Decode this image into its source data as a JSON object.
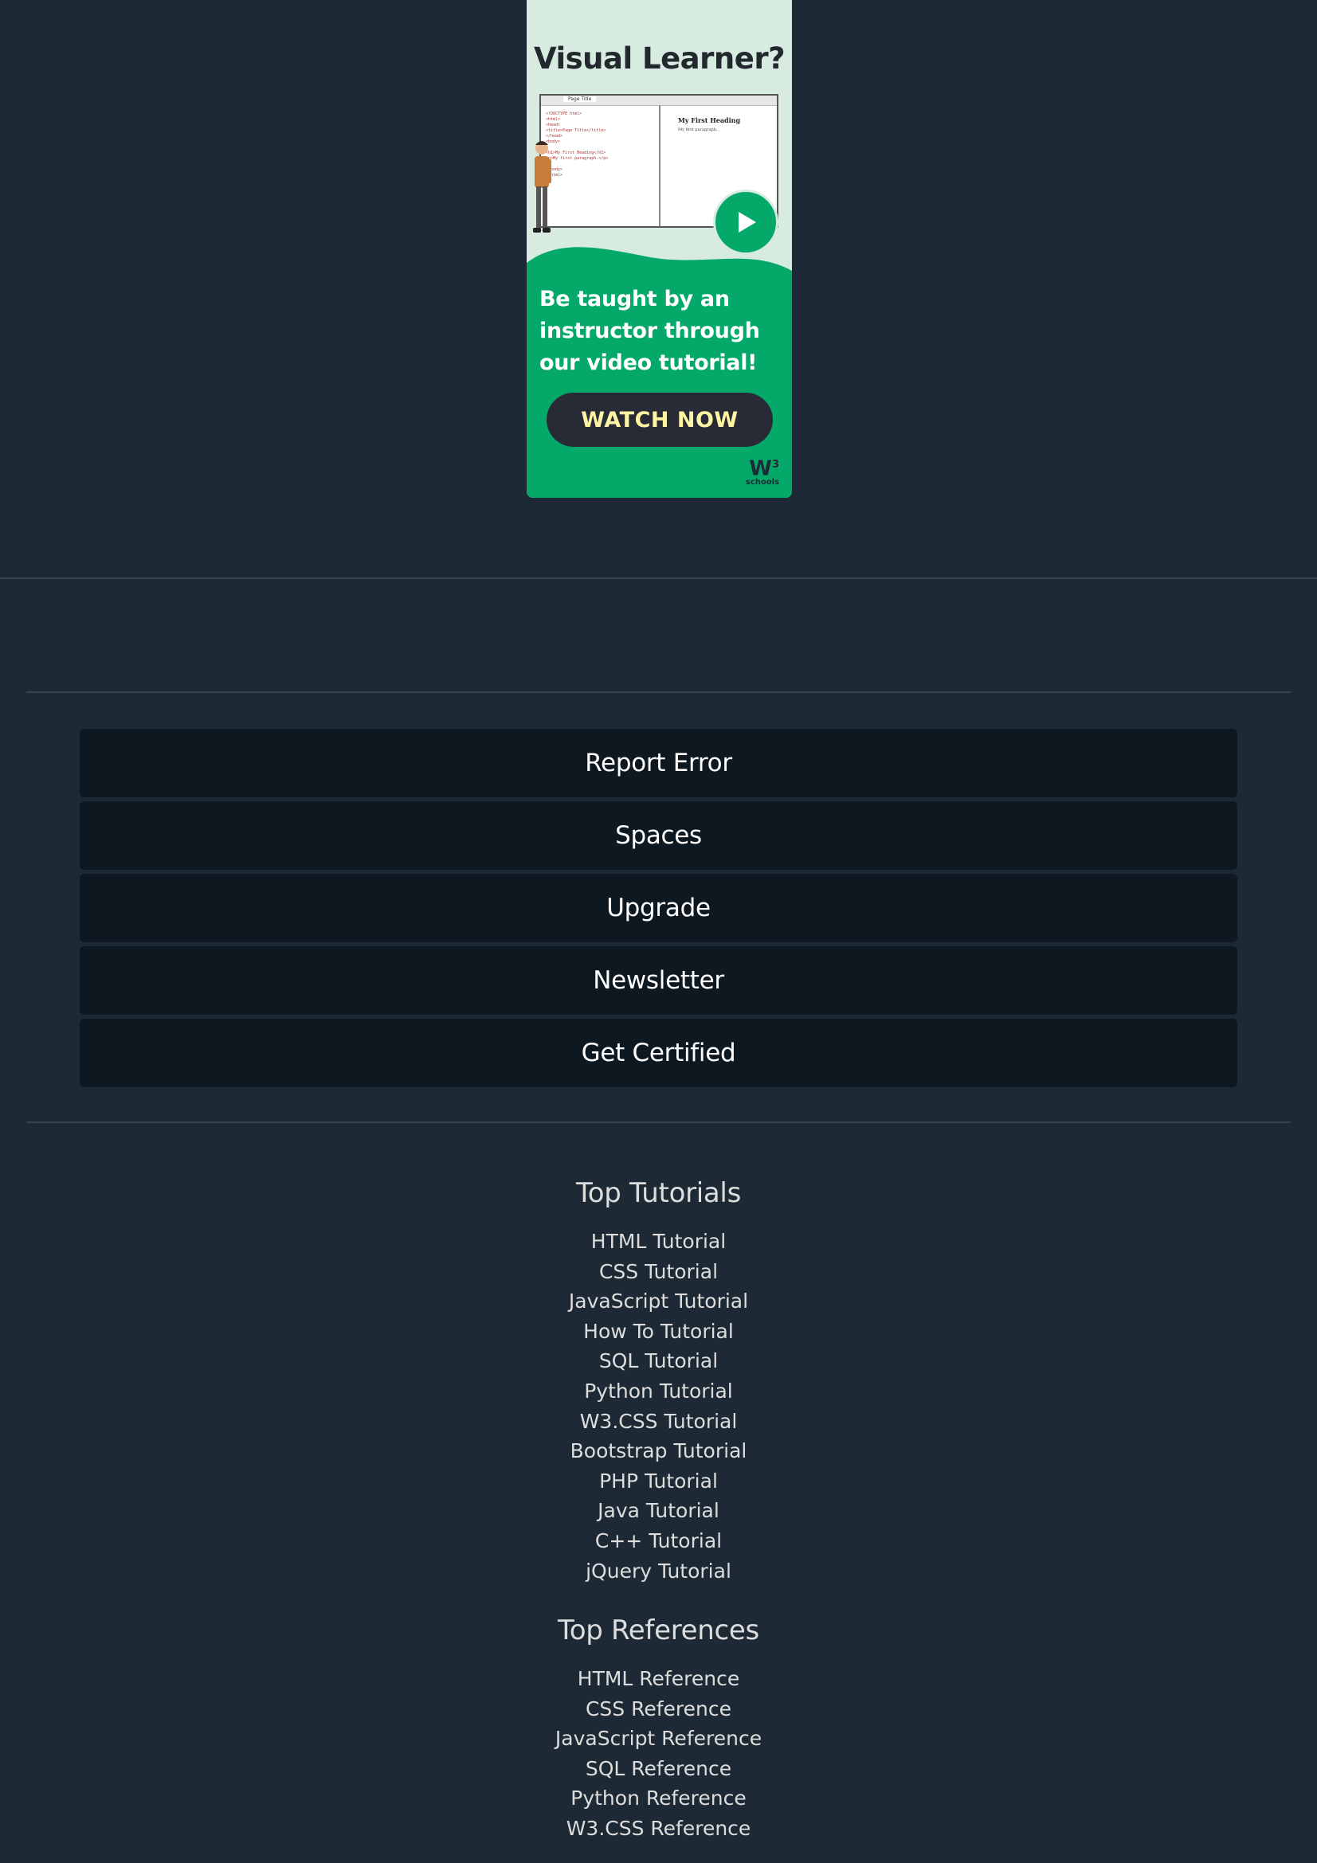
{
  "ad": {
    "title": "Visual Learner?",
    "window_tab": "Page Title",
    "window_heading": "My First Heading",
    "window_paragraph": "My first paragraph.",
    "code_lines": [
      "<!DOCTYPE html>",
      "<html>",
      "<head>",
      "<title>Page Title</title>",
      "</head>",
      "<body>",
      "",
      "<h1>My First Heading</h1>",
      "<p>My first paragraph.</p>",
      "",
      "</body>",
      "</html>"
    ],
    "body_lines": [
      "Be taught by an",
      "instructor through",
      "our video tutorial!"
    ],
    "cta": "WATCH NOW",
    "logo_mark": "W",
    "logo_sup": "3",
    "logo_text": "schools",
    "colors": {
      "background": "#d7ebe0",
      "green": "#04a96a",
      "cta_bg": "#282a35",
      "cta_text": "#fff4a3"
    }
  },
  "footer_buttons": [
    "Report Error",
    "Spaces",
    "Upgrade",
    "Newsletter",
    "Get Certified"
  ],
  "top_tutorials": {
    "heading": "Top Tutorials",
    "links": [
      "HTML Tutorial",
      "CSS Tutorial",
      "JavaScript Tutorial",
      "How To Tutorial",
      "SQL Tutorial",
      "Python Tutorial",
      "W3.CSS Tutorial",
      "Bootstrap Tutorial",
      "PHP Tutorial",
      "Java Tutorial",
      "C++ Tutorial",
      "jQuery Tutorial"
    ]
  },
  "top_references": {
    "heading": "Top References",
    "links": [
      "HTML Reference",
      "CSS Reference",
      "JavaScript Reference",
      "SQL Reference",
      "Python Reference",
      "W3.CSS Reference"
    ]
  },
  "colors": {
    "page_bg": "#1d2a35",
    "button_bg": "#0d1821",
    "separator": "#38444d",
    "text": "#dddddd"
  }
}
